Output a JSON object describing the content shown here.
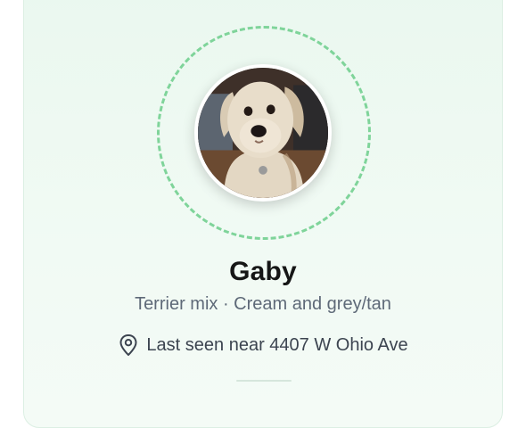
{
  "pet": {
    "name": "Gaby",
    "breed_line": "Terrier mix · Cream and grey/tan",
    "location": "Last seen near 4407 W Ohio Ave"
  },
  "photo": {
    "description_icon": "dog-photo"
  },
  "colors": {
    "accent_green": "#7fd49a",
    "card_bg": "#eaf8ef",
    "name_text": "#161616",
    "muted_text": "#5e6978"
  },
  "icons": {
    "location": "map-pin-icon"
  }
}
